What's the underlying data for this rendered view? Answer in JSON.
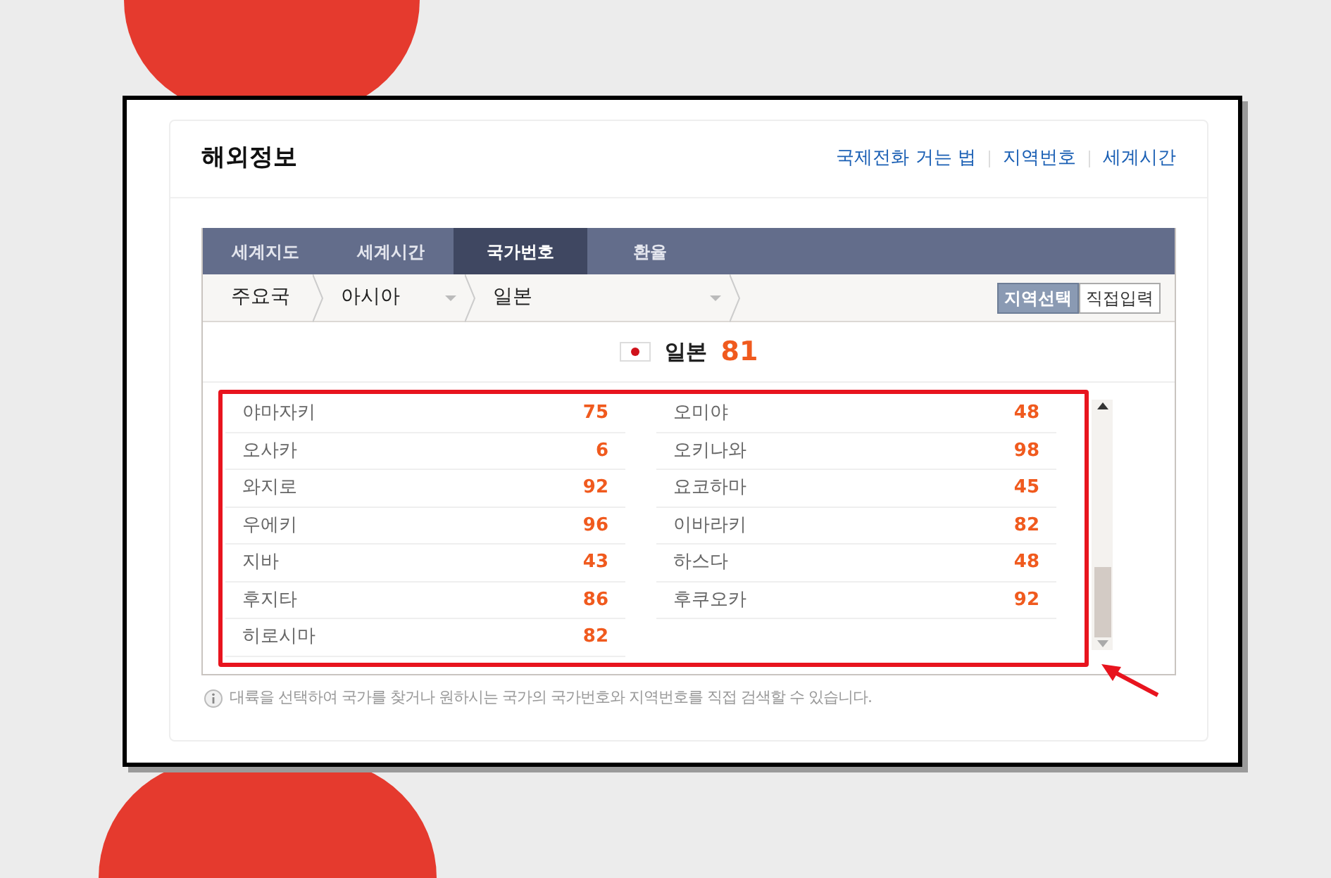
{
  "title": "해외정보",
  "header_links": [
    "국제전화 거는 법",
    "지역번호",
    "세계시간"
  ],
  "tabs": [
    {
      "label": "세계지도",
      "selected": false
    },
    {
      "label": "세계시간",
      "selected": false
    },
    {
      "label": "국가번호",
      "selected": true
    },
    {
      "label": "환율",
      "selected": false
    }
  ],
  "breadcrumb": [
    {
      "label": "주요국",
      "kind": "text"
    },
    {
      "label": "아시아",
      "kind": "dropdown"
    },
    {
      "label": "일본",
      "kind": "dropdown"
    }
  ],
  "mode_buttons": [
    {
      "label": "지역선택",
      "selected": true
    },
    {
      "label": "직접입력",
      "selected": false
    }
  ],
  "country": {
    "name": "일본",
    "code": "81"
  },
  "regions": [
    {
      "name": "야마자키",
      "code": "75"
    },
    {
      "name": "오사카",
      "code": "6"
    },
    {
      "name": "와지로",
      "code": "92"
    },
    {
      "name": "우에키",
      "code": "96"
    },
    {
      "name": "지바",
      "code": "43"
    },
    {
      "name": "후지타",
      "code": "86"
    },
    {
      "name": "히로시마",
      "code": "82"
    },
    {
      "name": "오미야",
      "code": "48"
    },
    {
      "name": "오키나와",
      "code": "98"
    },
    {
      "name": "요코하마",
      "code": "45"
    },
    {
      "name": "이바라키",
      "code": "82"
    },
    {
      "name": "하스다",
      "code": "48"
    },
    {
      "name": "후쿠오카",
      "code": "92"
    }
  ],
  "note": "대륙을 선택하여 국가를 찾거나 원하시는 국가의 국가번호와 지역번호를 직접 검색할 수 있습니다."
}
